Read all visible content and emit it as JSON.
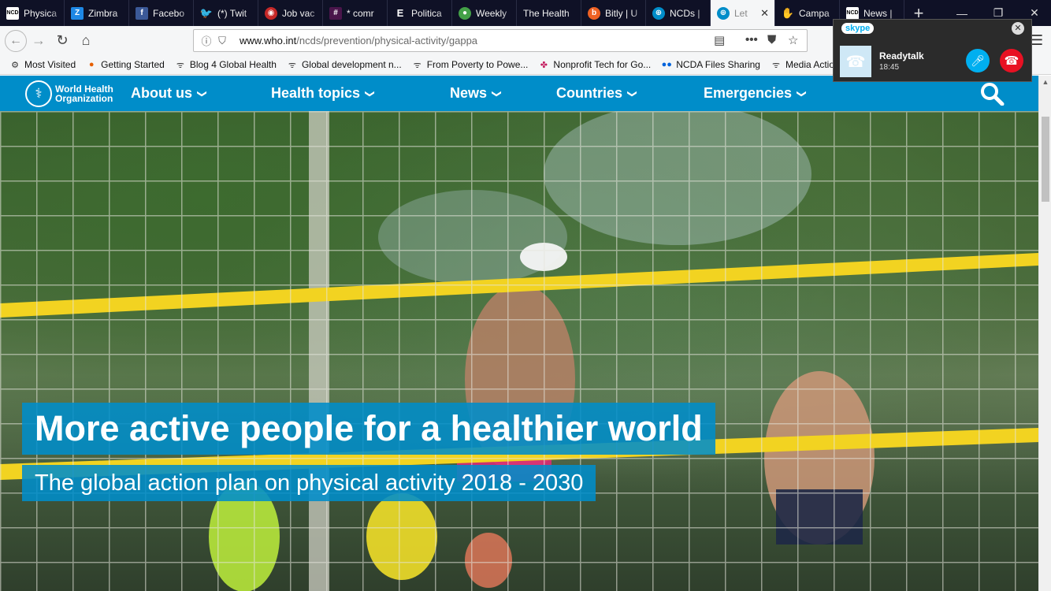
{
  "tabs": [
    {
      "label": "Physica",
      "icon": "ncd",
      "color": "#ffffff"
    },
    {
      "label": "Zimbra",
      "icon": "zimbra",
      "color": "#1e88e5"
    },
    {
      "label": "Facebo",
      "icon": "facebook",
      "color": "#3b5998"
    },
    {
      "label": "(*) Twit",
      "icon": "twitter",
      "color": "#1da1f2"
    },
    {
      "label": "Job vac",
      "icon": "job",
      "color": "#c62828"
    },
    {
      "label": "* comr",
      "icon": "slack",
      "color": "#4a154b"
    },
    {
      "label": "Politica",
      "icon": "politico",
      "color": "#000000"
    },
    {
      "label": "Weekly",
      "icon": "weekly",
      "color": "#43a047"
    },
    {
      "label": "The Health",
      "icon": "none",
      "color": "#000000"
    },
    {
      "label": "Bitly | U",
      "icon": "bitly",
      "color": "#ee6123"
    },
    {
      "label": "NCDs |",
      "icon": "who",
      "color": "#008dc9"
    },
    {
      "label": "Let",
      "icon": "who",
      "color": "#008dc9"
    },
    {
      "label": "Campa",
      "icon": "campa",
      "color": "#f5a623"
    },
    {
      "label": "News |",
      "icon": "ncd",
      "color": "#ffffff"
    }
  ],
  "nav": {
    "url_host": "www.who.int",
    "url_path": "/ncds/prevention/physical-activity/gappa"
  },
  "bookmarks": [
    {
      "label": "Most Visited",
      "icon": "gear-icon"
    },
    {
      "label": "Getting Started",
      "icon": "firefox-icon"
    },
    {
      "label": "Blog 4 Global Health",
      "icon": "rss-icon"
    },
    {
      "label": "Global development n...",
      "icon": "rss-icon"
    },
    {
      "label": "From Poverty to Powe...",
      "icon": "rss-icon"
    },
    {
      "label": "Nonprofit Tech for Go...",
      "icon": "puzzle-icon"
    },
    {
      "label": "NCDA Files Sharing",
      "icon": "flickr-icon"
    },
    {
      "label": "Media Action In",
      "icon": "rss-icon"
    }
  ],
  "who": {
    "logo_line1": "World Health",
    "logo_line2": "Organization",
    "menu": [
      "About us",
      "Health topics",
      "News",
      "Countries",
      "Emergencies"
    ]
  },
  "hero": {
    "title": "More active people for a healthier world",
    "subtitle": "The global action plan on physical activity 2018 - 2030"
  },
  "skype": {
    "brand": "skype",
    "caller": "Readytalk",
    "time": "18:45"
  },
  "colors": {
    "who_blue": "#008dc9",
    "tabstrip": "#0f1126",
    "skype_blue": "#00aff0",
    "hangup_red": "#e81123"
  }
}
